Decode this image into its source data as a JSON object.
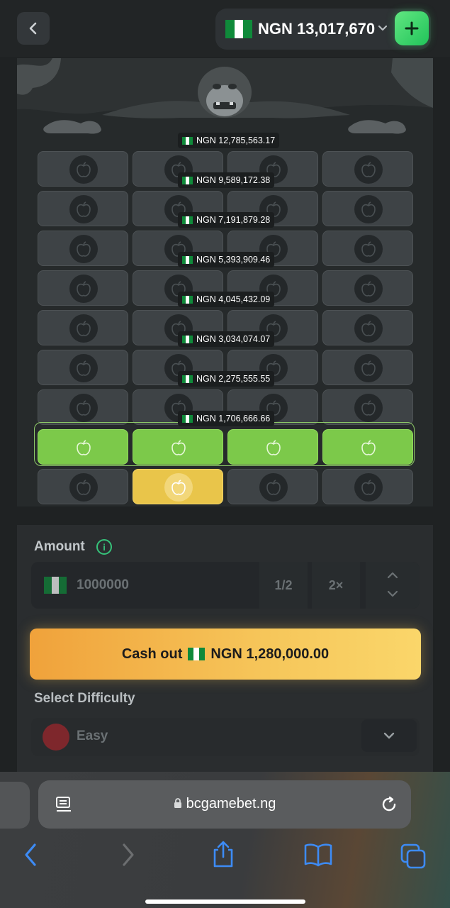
{
  "header": {
    "balance_currency": "NGN",
    "balance_amount": "13,017,670",
    "balance_text": "NGN 13,017,670",
    "icons": [
      "back-chevron-icon",
      "nigeria-flag-icon",
      "chevron-down-icon",
      "plus-icon"
    ]
  },
  "game": {
    "rows": 9,
    "columns": 4,
    "multipliers": [
      "NGN 12,785,563.17",
      "NGN 9,589,172.38",
      "NGN 7,191,879.28",
      "NGN 5,393,909.46",
      "NGN 4,045,432.09",
      "NGN 3,034,074.07",
      "NGN 2,275,555.55",
      "NGN 1,706,666.66"
    ],
    "revealed_row": {
      "row": 8,
      "state": "all-apples"
    },
    "picked_row": {
      "row": 9,
      "picked_column": 2
    },
    "colors": {
      "tile": "#3e4346",
      "green": "#7cc94a",
      "gold": "#e9c54a"
    }
  },
  "controls": {
    "amount_label": "Amount",
    "amount_value": "1000000",
    "half_label": "1/2",
    "double_label": "2×",
    "cashout_label": "Cash out",
    "cashout_amount": "NGN 1,280,000.00",
    "difficulty_label": "Select Difficulty",
    "difficulty_value": "Easy",
    "accent_color": "#f6c65a"
  },
  "browser": {
    "url": "bcgamebet.ng",
    "icons": [
      "reader-icon",
      "lock-icon",
      "reload-icon",
      "back-icon",
      "forward-icon",
      "share-icon",
      "bookmarks-icon",
      "tabs-icon"
    ]
  }
}
